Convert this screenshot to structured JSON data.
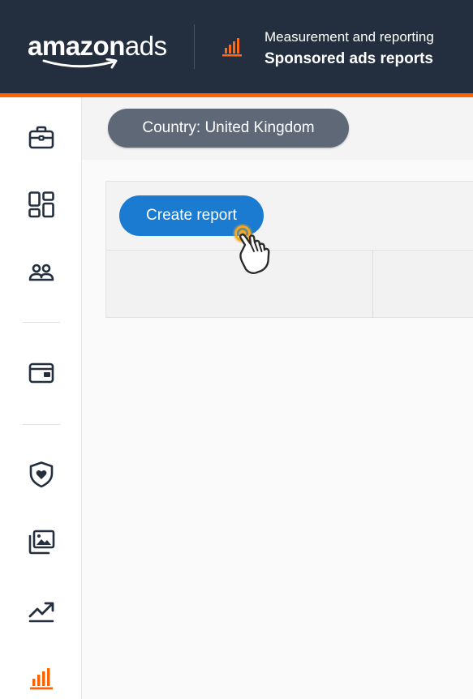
{
  "header": {
    "logo_bold": "amazon",
    "logo_light": "ads",
    "subtitle": "Measurement and reporting",
    "title": "Sponsored ads reports",
    "icon": "bar-chart-icon"
  },
  "colors": {
    "header_bg": "#232f3e",
    "accent": "#ff6200",
    "chip_bg": "#5e6877",
    "primary_button": "#1a7bd0",
    "cursor_highlight": "#f5a623"
  },
  "sidebar": {
    "items": [
      {
        "name": "campaigns",
        "icon": "briefcase-icon"
      },
      {
        "name": "dashboard",
        "icon": "grid-layout-icon"
      },
      {
        "name": "audiences",
        "icon": "people-icon"
      },
      {
        "name": "billing",
        "icon": "wallet-icon"
      },
      {
        "name": "brand-safety",
        "icon": "shield-heart-icon"
      },
      {
        "name": "creative-assets",
        "icon": "image-stack-icon"
      },
      {
        "name": "trends",
        "icon": "trend-up-icon"
      },
      {
        "name": "reports",
        "icon": "bar-chart-icon",
        "active": true
      }
    ]
  },
  "filters": {
    "country_chip": "Country: United Kingdom"
  },
  "toolbar": {
    "create_report_label": "Create report"
  }
}
